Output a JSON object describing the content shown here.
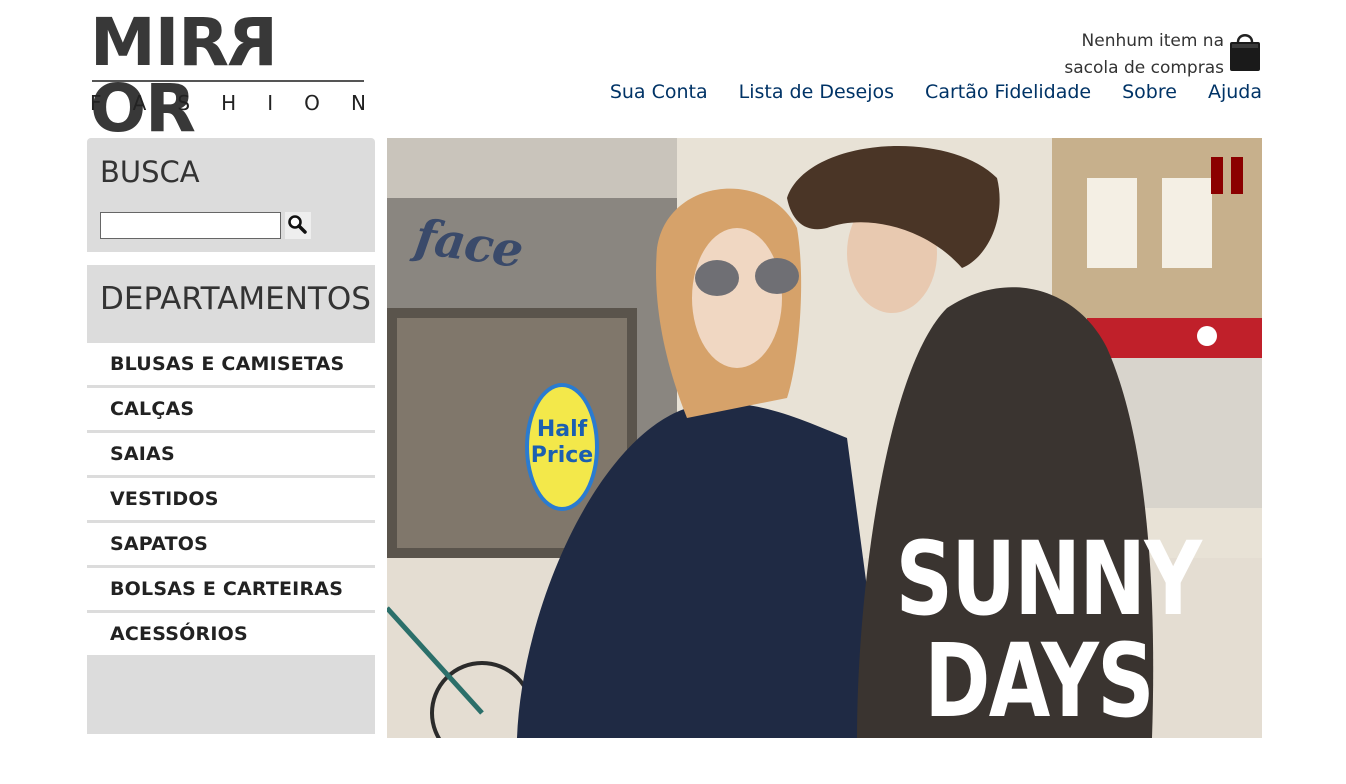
{
  "brand": {
    "logo_main": "MIRROR",
    "logo_sub_letters": [
      "F",
      "A",
      "S",
      "H",
      "I",
      "O",
      "N"
    ]
  },
  "cart": {
    "line1": "Nenhum item na",
    "line2": "sacola de compras",
    "icon": "shopping-bag-icon"
  },
  "menu": {
    "items": [
      {
        "label": "Sua Conta"
      },
      {
        "label": "Lista de Desejos"
      },
      {
        "label": "Cartão Fidelidade"
      },
      {
        "label": "Sobre"
      },
      {
        "label": "Ajuda"
      }
    ]
  },
  "search": {
    "title": "BUSCA",
    "value": "",
    "icon": "magnifier-icon"
  },
  "departments": {
    "title": "DEPARTAMENTOS",
    "items": [
      {
        "label": "BLUSAS E CAMISETAS"
      },
      {
        "label": "CALÇAS"
      },
      {
        "label": "SAIAS"
      },
      {
        "label": "VESTIDOS"
      },
      {
        "label": "SAPATOS"
      },
      {
        "label": "BOLSAS E CARTEIRAS"
      },
      {
        "label": "ACESSÓRIOS"
      }
    ]
  },
  "banner": {
    "headline_line1": "SUNNY",
    "headline_line2": "DAYS",
    "sign_text_1": "Half",
    "sign_text_2": "Price",
    "store_sign": "face",
    "pause_icon": "pause-icon",
    "accent_color": "#8b0000"
  }
}
